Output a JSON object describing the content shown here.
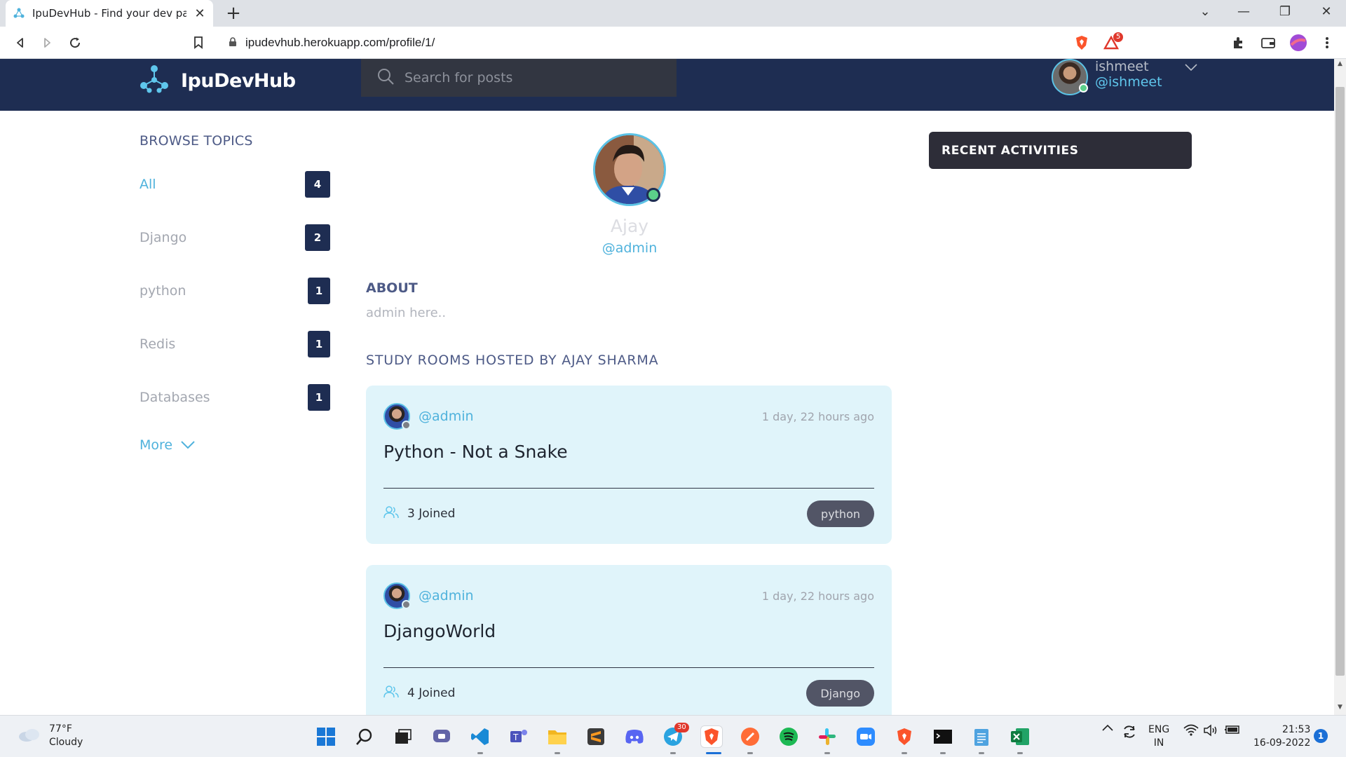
{
  "browser": {
    "tab_title": "IpuDevHub - Find your dev partn",
    "url": "ipudevhub.herokuapp.com/profile/1/",
    "brave_shield_badge": "5"
  },
  "header": {
    "logo_text": "IpuDevHub",
    "search_placeholder": "Search for posts",
    "user_name": "ishmeet",
    "user_handle": "@ishmeet"
  },
  "sidebar": {
    "title": "BROWSE TOPICS",
    "topics": [
      {
        "label": "All",
        "count": "4"
      },
      {
        "label": "Django",
        "count": "2"
      },
      {
        "label": "python",
        "count": "1"
      },
      {
        "label": "Redis",
        "count": "1"
      },
      {
        "label": "Databases",
        "count": "1"
      }
    ],
    "more_label": "More"
  },
  "profile": {
    "name": "Ajay",
    "handle": "@admin",
    "about_title": "ABOUT",
    "about_text": "admin here..",
    "rooms_title": "STUDY ROOMS HOSTED BY AJAY SHARMA"
  },
  "rooms": [
    {
      "host": "@admin",
      "time": "1 day, 22 hours ago",
      "title": "Python - Not a Snake",
      "joined": "3 Joined",
      "topic": "python"
    },
    {
      "host": "@admin",
      "time": "1 day, 22 hours ago",
      "title": "DjangoWorld",
      "joined": "4 Joined",
      "topic": "Django"
    }
  ],
  "recent_activities": {
    "title": "RECENT ACTIVITIES"
  },
  "taskbar": {
    "weather_temp": "77°F",
    "weather_desc": "Cloudy",
    "telegram_badge": "30",
    "lang": "ENG",
    "region": "IN",
    "time": "21:53",
    "date": "16-09-2022",
    "notifications": "1"
  },
  "colors": {
    "header_bg": "#1e2d52",
    "accent": "#4fb2dc",
    "card_bg": "#e0f4fa",
    "recent_bg": "#2d2d38"
  }
}
